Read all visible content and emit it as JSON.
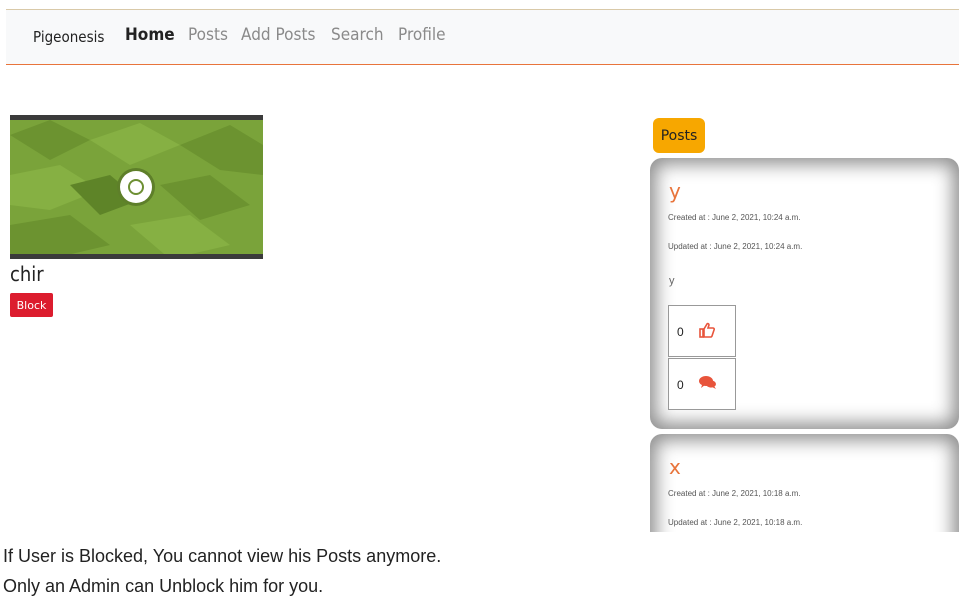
{
  "navbar": {
    "brand": "Pigeonesis",
    "items": [
      {
        "label": "Home",
        "active": true
      },
      {
        "label": "Posts",
        "active": false
      },
      {
        "label": "Add Posts",
        "active": false
      },
      {
        "label": "Search",
        "active": false
      },
      {
        "label": "Profile",
        "active": false
      }
    ]
  },
  "profile": {
    "username": "chir",
    "block_label": "Block"
  },
  "posts_panel": {
    "label": "Posts",
    "posts": [
      {
        "title": "y",
        "created": "Created at : June 2, 2021, 10:24 a.m.",
        "updated": "Updated at : June 2, 2021, 10:24 a.m.",
        "body": "y",
        "likes": "0",
        "comments": "0"
      },
      {
        "title": "x",
        "created": "Created at : June 2, 2021, 10:18 a.m.",
        "updated": "Updated at : June 2, 2021, 10:18 a.m."
      }
    ]
  },
  "caption": {
    "line1": "If User is Blocked, You cannot view his Posts anymore.",
    "line2": "Only an Admin can Unblock him for you."
  },
  "colors": {
    "accent": "#e8743b",
    "block": "#dc1c2e",
    "posts_label": "#f7a700"
  }
}
